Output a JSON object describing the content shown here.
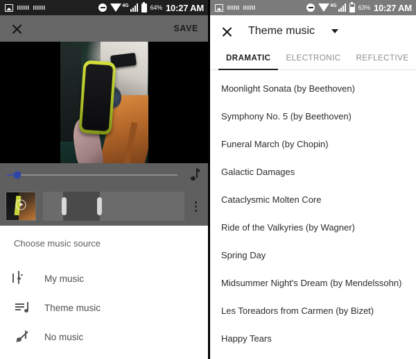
{
  "left_panel": {
    "statusbar": {
      "battery_percent": "64%",
      "clock": "10:27 AM",
      "network": "4G"
    },
    "toolbar": {
      "close_label": "",
      "save_label": "SAVE"
    },
    "player": {
      "seek_position_percent": 6
    },
    "timeline": {
      "overflow_label": ""
    },
    "sheet": {
      "title": "Choose music source",
      "items": [
        {
          "label": "My music",
          "icon": "library-music-icon"
        },
        {
          "label": "Theme music",
          "icon": "queue-music-icon"
        },
        {
          "label": "No music",
          "icon": "music-off-icon"
        }
      ]
    }
  },
  "right_panel": {
    "statusbar": {
      "battery_percent": "63%",
      "clock": "10:27 AM",
      "network": "4G"
    },
    "toolbar": {
      "title": "Theme music"
    },
    "tabs": [
      {
        "label": "DRAMATIC",
        "active": true
      },
      {
        "label": "ELECTRONIC",
        "active": false
      },
      {
        "label": "REFLECTIVE",
        "active": false
      }
    ],
    "tracks": [
      "Moonlight Sonata (by Beethoven)",
      "Symphony No. 5 (by Beethoven)",
      "Funeral March (by Chopin)",
      "Galactic Damages",
      "Cataclysmic Molten Core",
      "Ride of the Valkyries (by Wagner)",
      "Spring Day",
      "Midsummer Night's Dream (by Mendelssohn)",
      "Les Toreadors from Carmen (by Bizet)",
      "Happy Tears"
    ]
  },
  "colors": {
    "accent_blue": "#2f46a8",
    "toolbar_gray": "#676767",
    "statusbar_dark": "#1f1f1f",
    "statusbar_gray": "#7b7b7b"
  }
}
